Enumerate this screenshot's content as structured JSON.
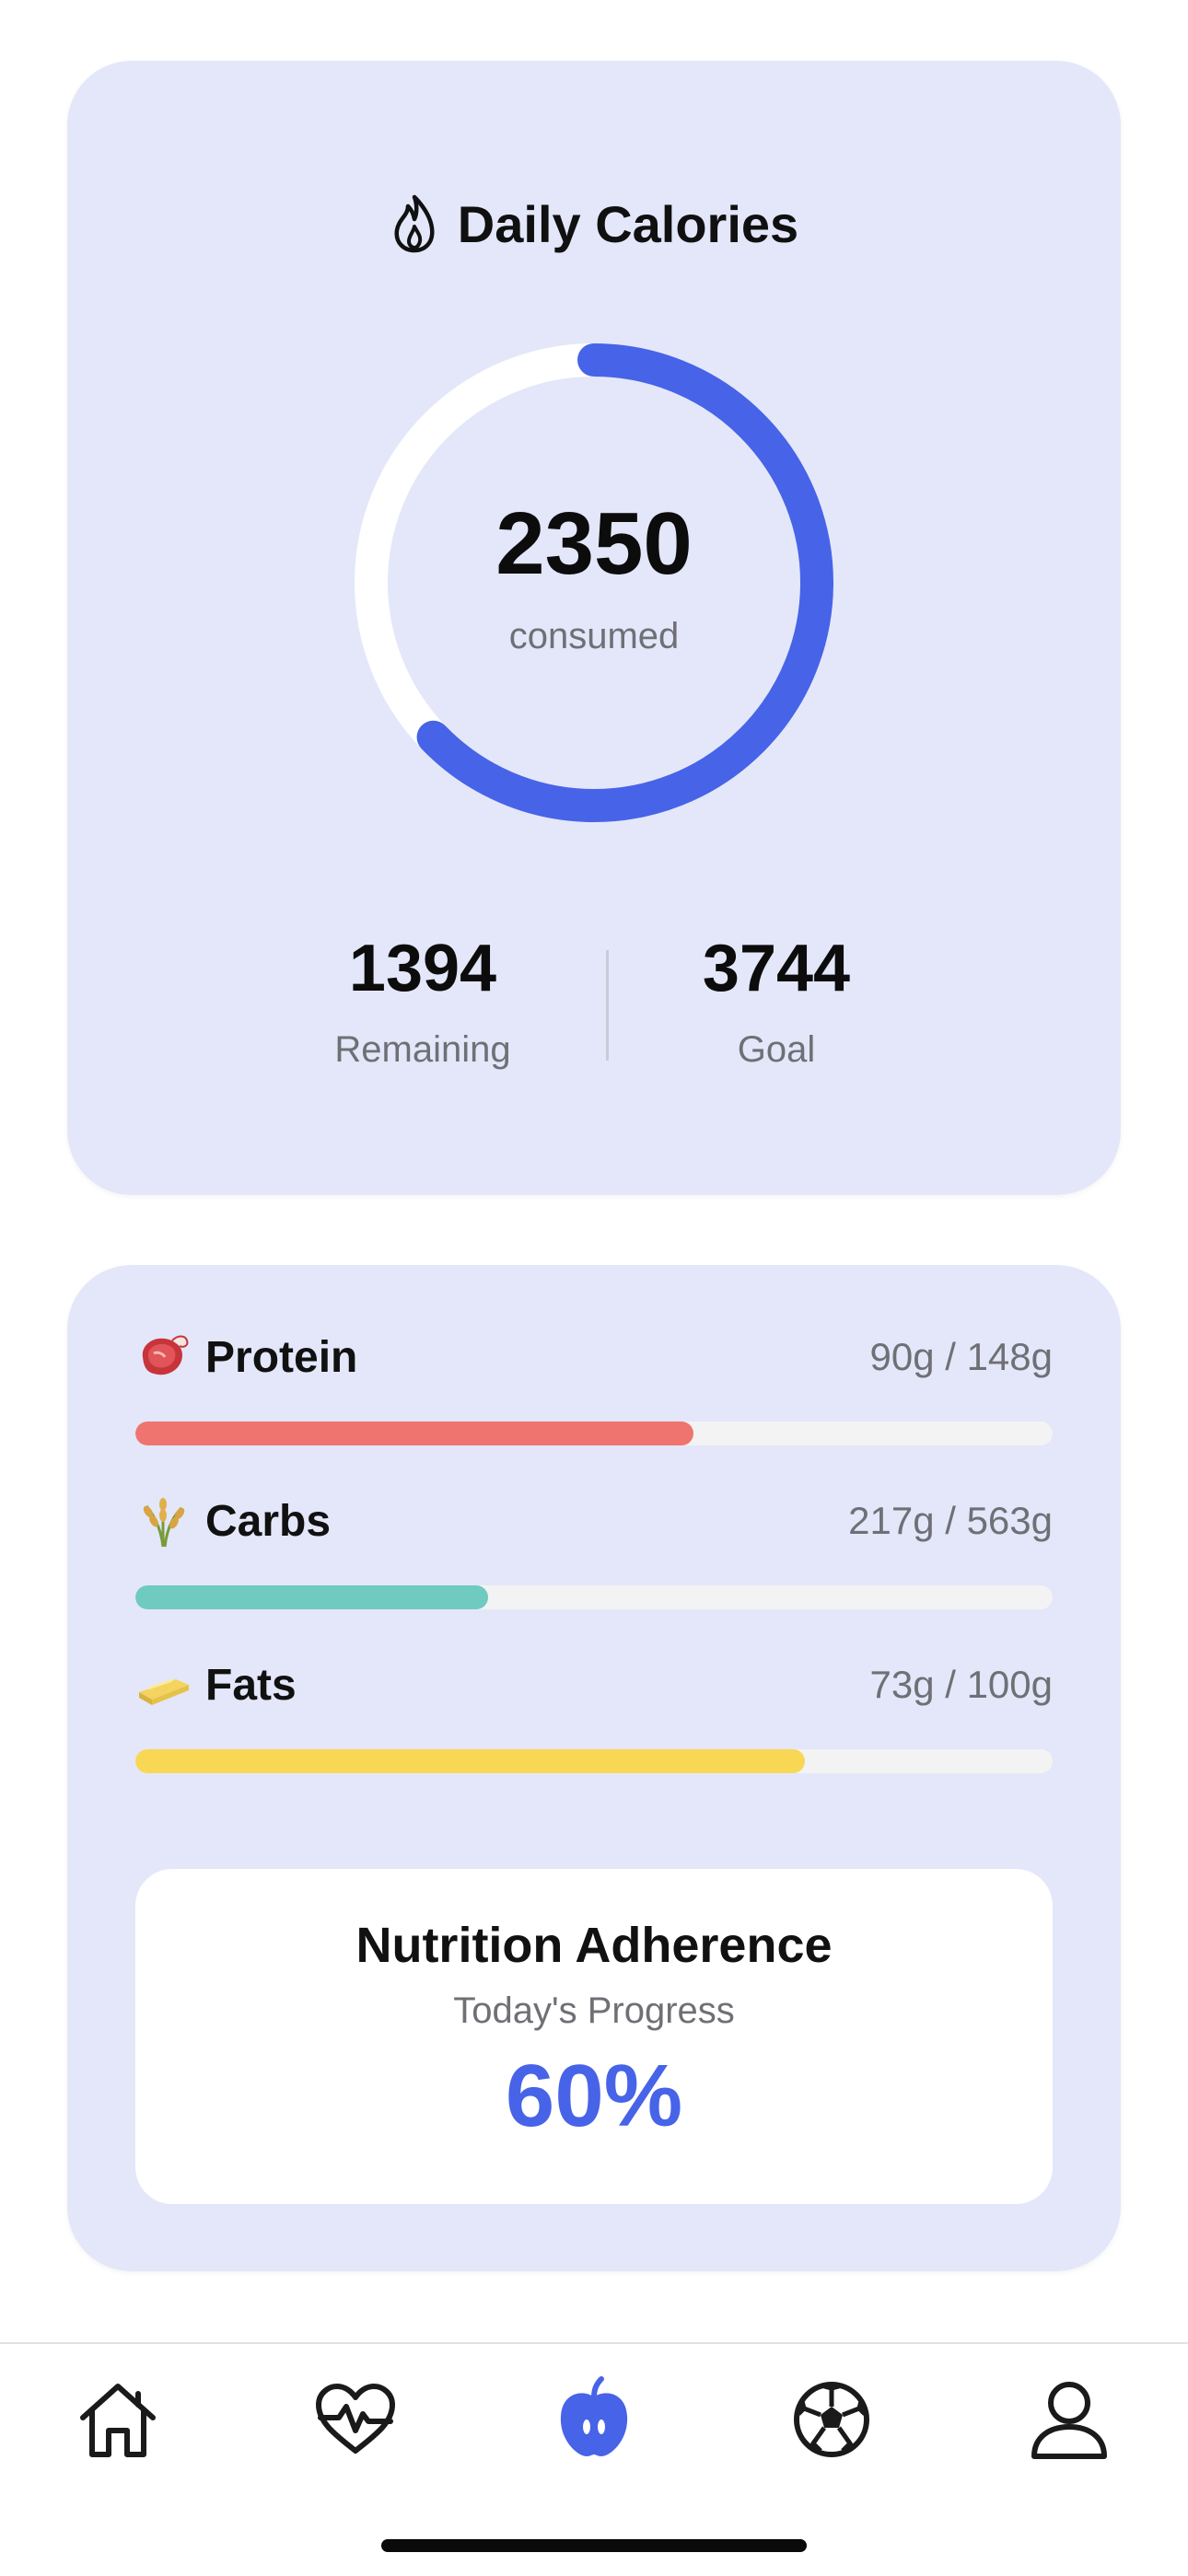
{
  "calories": {
    "title": "Daily Calories",
    "consumed": "2350",
    "consumed_label": "consumed",
    "remaining": "1394",
    "remaining_label": "Remaining",
    "goal": "3744",
    "goal_label": "Goal",
    "progress": 0.628,
    "ring_color": "#4763e8",
    "icon": "flame-icon"
  },
  "macros": [
    {
      "key": "protein",
      "name": "Protein",
      "amount": "90g / 148g",
      "progress": 0.608,
      "color": "#ef7470",
      "icon": "meat-emoji"
    },
    {
      "key": "carbs",
      "name": "Carbs",
      "amount": "217g / 563g",
      "progress": 0.385,
      "color": "#6fcac0",
      "icon": "rice-emoji"
    },
    {
      "key": "fats",
      "name": "Fats",
      "amount": "73g / 100g",
      "progress": 0.73,
      "color": "#f8d754",
      "icon": "butter-emoji"
    }
  ],
  "adherence": {
    "title": "Nutrition Adherence",
    "subtitle": "Today's Progress",
    "value": "60%",
    "color": "#4763e8"
  },
  "tabs": [
    {
      "icon": "home-icon",
      "active": false
    },
    {
      "icon": "heart-pulse-icon",
      "active": false
    },
    {
      "icon": "apple-icon",
      "active": true
    },
    {
      "icon": "soccer-ball-icon",
      "active": false
    },
    {
      "icon": "person-icon",
      "active": false
    }
  ]
}
